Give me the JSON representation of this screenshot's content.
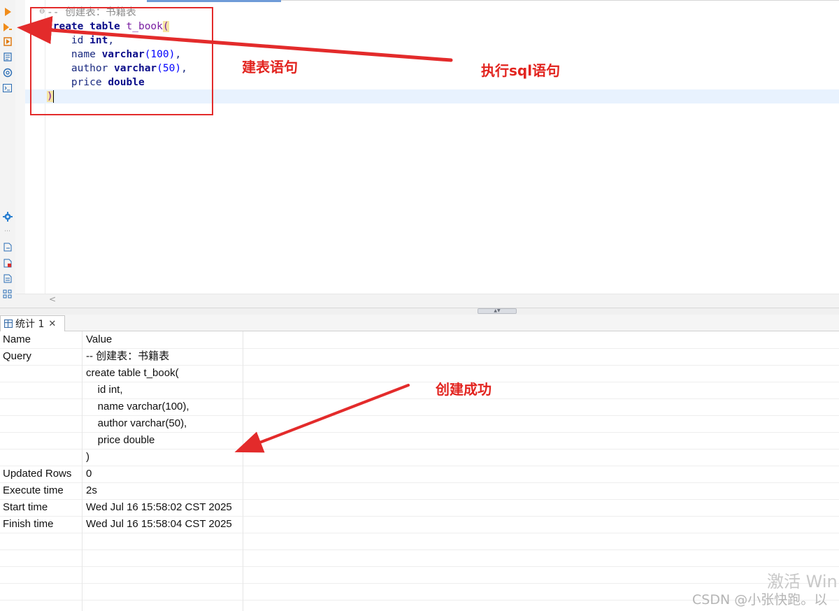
{
  "editor": {
    "lines": [
      {
        "comment": "-- 创建表：书籍表"
      },
      {
        "kw1": "create",
        "kw2": "table",
        "name": "t_book",
        "paren": "("
      },
      {
        "col": "id",
        "type": "int",
        "suffix": ","
      },
      {
        "col": "name",
        "type": "varchar",
        "args": "(100)",
        "suffix": ","
      },
      {
        "col": "author",
        "type": "varchar",
        "args": "(50)",
        "suffix": ","
      },
      {
        "col": "price",
        "type": "double"
      },
      {
        "close": ")"
      }
    ],
    "fold_marker": "⊖",
    "hscroll_arrow": "<"
  },
  "toolbar_icons": [
    "run-icon",
    "run-current-icon",
    "run-script-icon",
    "explain-icon",
    "ai-assistant-icon",
    "console-icon",
    "settings-icon",
    "export-icon",
    "export-pdf-icon",
    "format-icon",
    "schema-icon"
  ],
  "splitter": {
    "handle": "▲▼"
  },
  "result_tab": {
    "label": "统计 1",
    "close": "✕"
  },
  "result_grid": {
    "header": {
      "name": "Name",
      "value": "Value"
    },
    "rows": [
      {
        "name": "Query",
        "value": "-- 创建表：书籍表"
      },
      {
        "name": "",
        "value": "create table t_book("
      },
      {
        "name": "",
        "value": "    id int,"
      },
      {
        "name": "",
        "value": "    name varchar(100),"
      },
      {
        "name": "",
        "value": "    author varchar(50),"
      },
      {
        "name": "",
        "value": "    price double"
      },
      {
        "name": "",
        "value": ")"
      },
      {
        "name": "Updated Rows",
        "value": "0"
      },
      {
        "name": "Execute time",
        "value": "2s"
      },
      {
        "name": "Start time",
        "value": "Wed Jul 16 15:58:02 CST 2025"
      },
      {
        "name": "Finish time",
        "value": "Wed Jul 16 15:58:04 CST 2025"
      }
    ],
    "empty_rows": 5
  },
  "annotations": {
    "box_label": "建表语句",
    "exec_label": "执行sql语句",
    "success_label": "创建成功",
    "color": "#e32b2b"
  },
  "watermarks": {
    "windows": "激活 Win",
    "csdn": "CSDN @小张快跑。以"
  }
}
